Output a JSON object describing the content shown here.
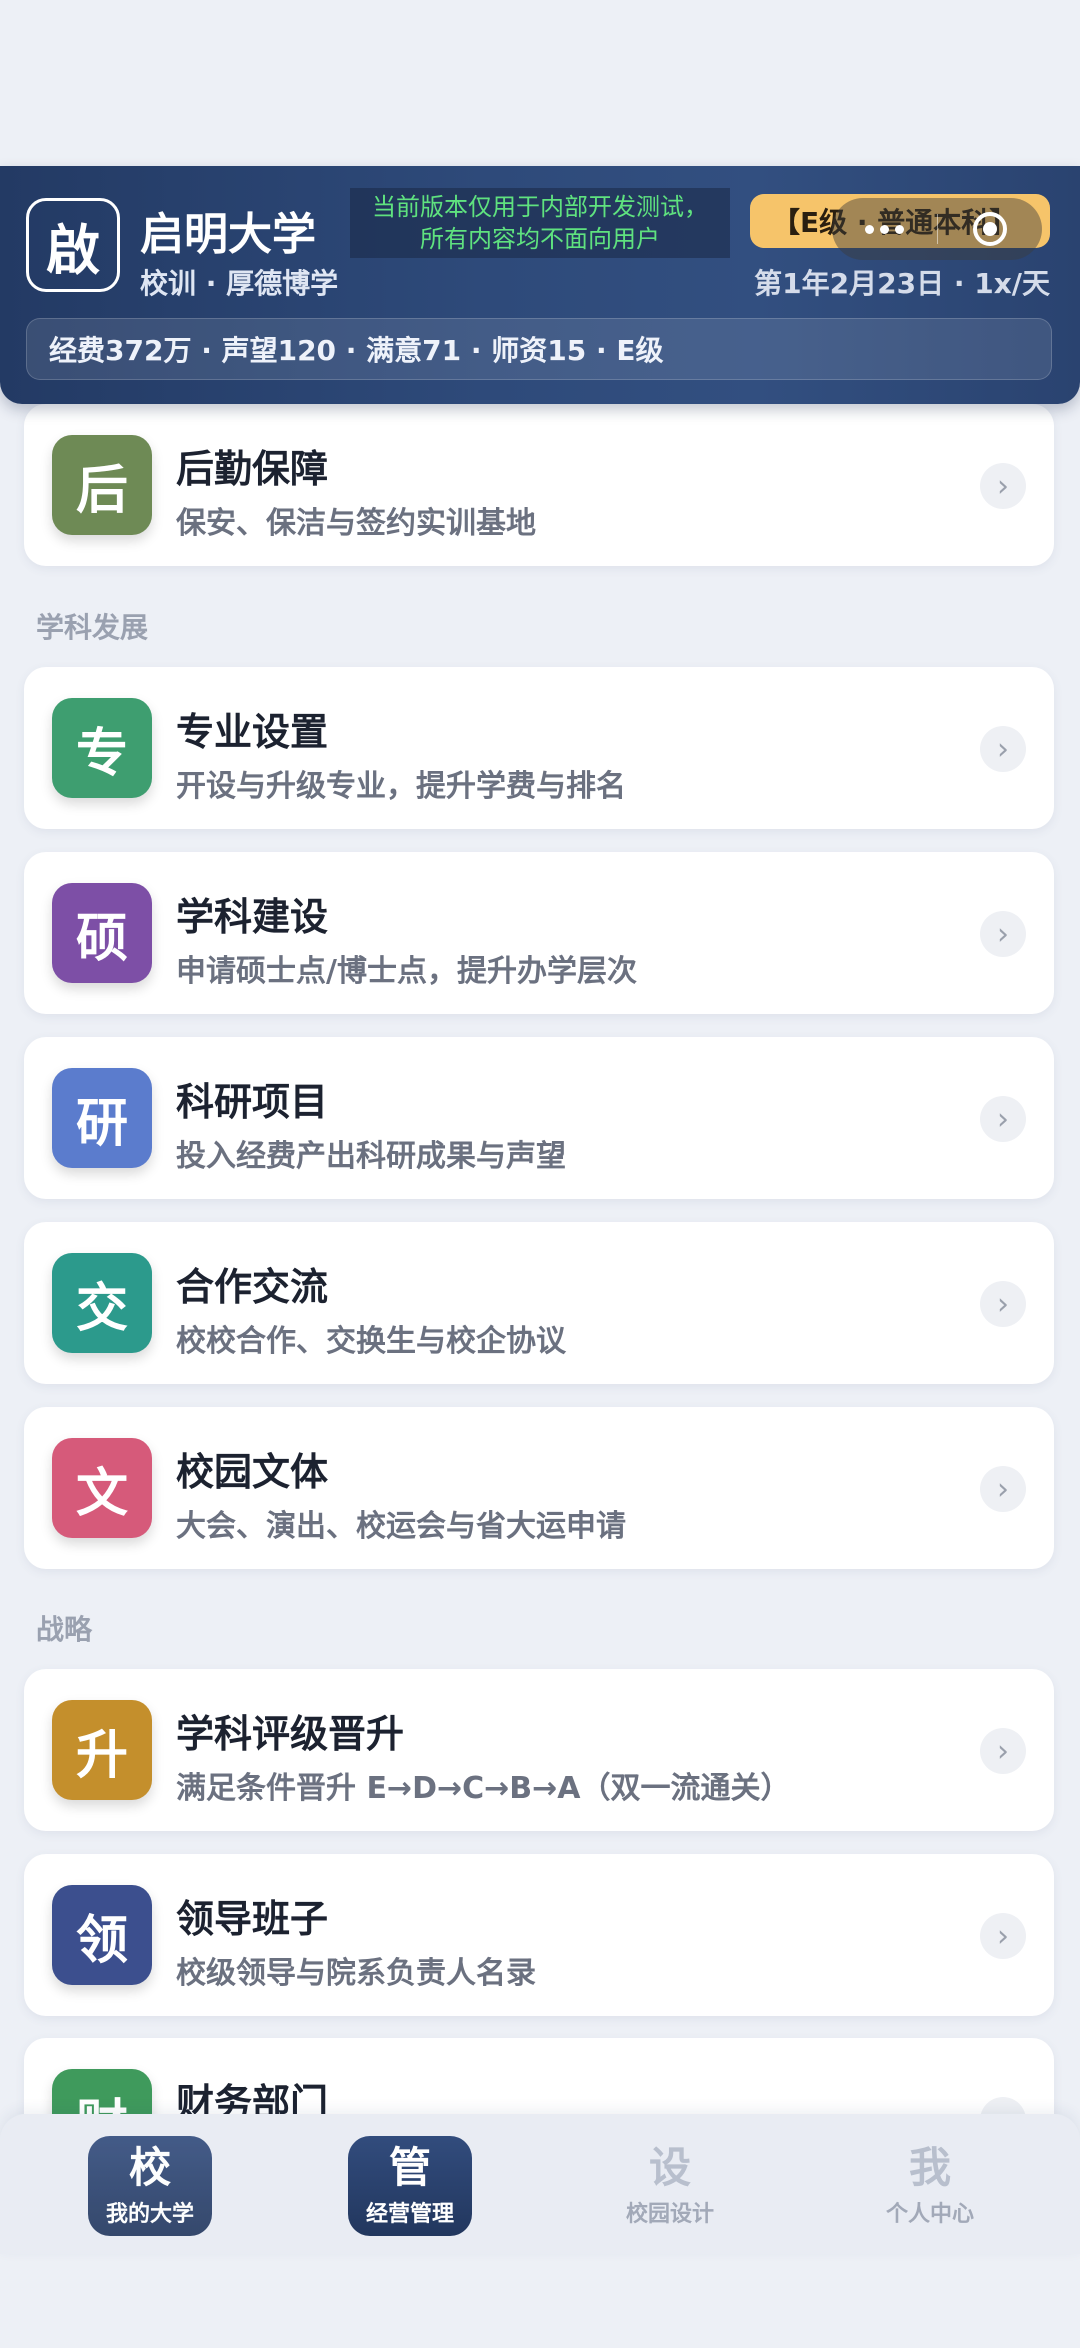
{
  "header": {
    "logo_char": "啟",
    "university_name": "启明大学",
    "motto": "校训 · 厚德博学",
    "notice_line1": "当前版本仅用于内部开发测试，",
    "notice_line2": "所有内容均不面向用户",
    "grade_badge": "【E级 · 普通本科】",
    "date_speed": "第1年2月23日 · 1x/天",
    "stats": "经费372万 · 声望120 · 满意71 · 师资15 · E级"
  },
  "sections": {
    "discipline": "学科发展",
    "strategy": "战略"
  },
  "cards": [
    {
      "icon": "后",
      "title": "后勤保障",
      "subtitle": "保安、保洁与签约实训基地",
      "color": "#6e8a55"
    },
    {
      "icon": "专",
      "title": "专业设置",
      "subtitle": "开设与升级专业，提升学费与排名",
      "color": "#3e9e70"
    },
    {
      "icon": "硕",
      "title": "学科建设",
      "subtitle": "申请硕士点/博士点，提升办学层次",
      "color": "#7d4fa6"
    },
    {
      "icon": "研",
      "title": "科研项目",
      "subtitle": "投入经费产出科研成果与声望",
      "color": "#5b7ccd"
    },
    {
      "icon": "交",
      "title": "合作交流",
      "subtitle": "校校合作、交换生与校企协议",
      "color": "#2c9a8c"
    },
    {
      "icon": "文",
      "title": "校园文体",
      "subtitle": "大会、演出、校运会与省大运申请",
      "color": "#d65a7a"
    },
    {
      "icon": "升",
      "title": "学科评级晋升",
      "subtitle": "满足条件晋升 E→D→C→B→A（双一流通关）",
      "color": "#c48f2c"
    },
    {
      "icon": "领",
      "title": "领导班子",
      "subtitle": "校级领导与院系负责人名录",
      "color": "#3c4f8e"
    },
    {
      "icon": "财",
      "title": "财务部门",
      "subtitle": "",
      "color": "#3f9a5c"
    }
  ],
  "nav": [
    {
      "glyph": "校",
      "label": "我的大学"
    },
    {
      "glyph": "管",
      "label": "经营管理"
    },
    {
      "glyph": "设",
      "label": "校园设计"
    },
    {
      "glyph": "我",
      "label": "个人中心"
    }
  ]
}
